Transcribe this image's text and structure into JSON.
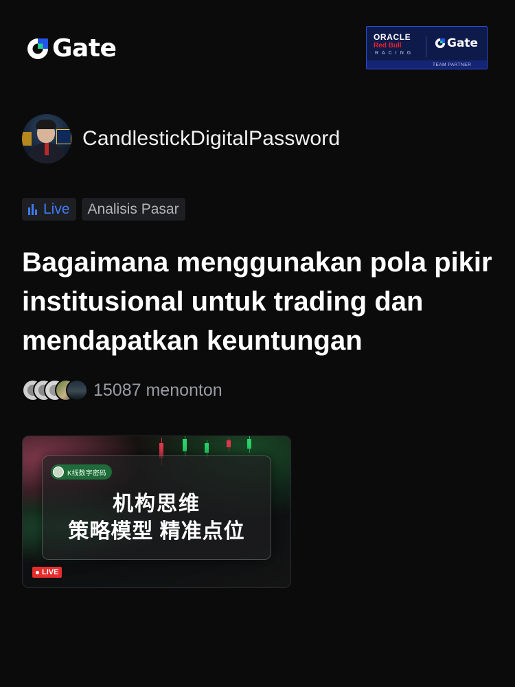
{
  "brand": {
    "logo_text": "Gate",
    "accent": "#2354e6",
    "partner_badge": {
      "line1": "ORACLE",
      "line2": "Red Bull",
      "line3": "RACING",
      "logo_text": "Gate",
      "caption": "TEAM PARTNER"
    }
  },
  "streamer": {
    "name": "CandlestickDigitalPassword"
  },
  "tags": {
    "live_label": "Live",
    "category": "Analisis Pasar",
    "live_color": "#3f7cf5"
  },
  "stream": {
    "title": "Bagaimana menggunakan pola pikir institusional untuk trading dan mendapatkan keuntungan",
    "viewers_text": "15087 menonton"
  },
  "thumbnail": {
    "channel_chip": "K线数字密码",
    "line1": "机构思维",
    "line2": "策略模型 精准点位",
    "live_badge": "LIVE"
  }
}
